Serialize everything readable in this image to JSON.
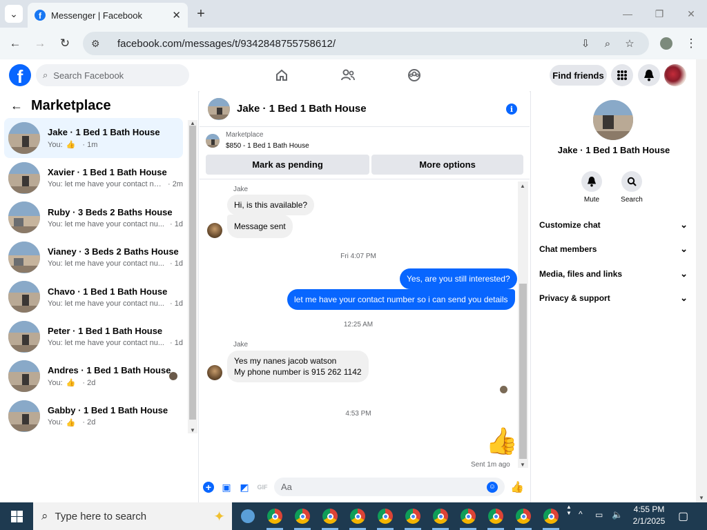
{
  "browser": {
    "tab_title": "Messenger | Facebook",
    "tab_favicon": "facebook-icon",
    "url": "facebook.com/messages/t/9342848755758612/"
  },
  "fb": {
    "search_placeholder": "Search Facebook",
    "find_friends": "Find friends"
  },
  "left": {
    "title": "Marketplace",
    "conversations": [
      {
        "name": "Jake · 1 Bed 1 Bath House",
        "prefix": "You:",
        "preview": "",
        "like": true,
        "time": "· 1m",
        "active": true
      },
      {
        "name": "Xavier · 1 Bed 1 Bath House",
        "prefix": "You:",
        "preview": "let me have your contact nu...",
        "like": false,
        "time": "· 2m",
        "active": false
      },
      {
        "name": "Ruby · 3 Beds 2 Baths House",
        "prefix": "You:",
        "preview": "let me have your contact nu...",
        "like": false,
        "time": "· 1d",
        "active": false
      },
      {
        "name": "Vianey · 3 Beds 2 Baths House",
        "prefix": "You:",
        "preview": "let me have your contact nu...",
        "like": false,
        "time": "· 1d",
        "active": false
      },
      {
        "name": "Chavo · 1 Bed 1 Bath House",
        "prefix": "You:",
        "preview": "let me have your contact nu...",
        "like": false,
        "time": "· 1d",
        "active": false
      },
      {
        "name": "Peter · 1 Bed 1 Bath House",
        "prefix": "You:",
        "preview": "let me have your contact nu...",
        "like": false,
        "time": "· 1d",
        "active": false
      },
      {
        "name": "Andres · 1 Bed 1 Bath House",
        "prefix": "You:",
        "preview": "",
        "like": true,
        "time": "· 2d",
        "active": false
      },
      {
        "name": "Gabby · 1 Bed 1 Bath House",
        "prefix": "You:",
        "preview": "",
        "like": true,
        "time": "· 2d",
        "active": false
      }
    ]
  },
  "chat": {
    "title": "Jake · 1 Bed 1 Bath House",
    "card_source": "Marketplace",
    "card_listing": "$850 - 1 Bed 1 Bath House",
    "btn_pending": "Mark as pending",
    "btn_more": "More options",
    "sender1": "Jake",
    "msg_available": "Hi, is this available?",
    "msg_sent_notice": "Message sent",
    "ts1": "Fri 4:07 PM",
    "out1": "Yes, are you still interested?",
    "out2": "let me have your contact number so i can send you details",
    "ts2": "12:25 AM",
    "sender2": "Jake",
    "in_reply_line1": "Yes my nanes jacob watson",
    "in_reply_line2": "My phone number is 915 262 1142",
    "ts3": "4:53 PM",
    "sent_status": "Sent 1m ago",
    "composer_placeholder": "Aa"
  },
  "right": {
    "name": "Jake · 1 Bed 1 Bath House",
    "mute": "Mute",
    "search": "Search",
    "sections": [
      "Customize chat",
      "Chat members",
      "Media, files and links",
      "Privacy & support"
    ]
  },
  "taskbar": {
    "search_placeholder": "Type here to search",
    "time": "4:55 PM",
    "date": "2/1/2025"
  },
  "colors": {
    "accent": "#0866ff",
    "bubble_in": "#f0f0f0",
    "active_row": "#ebf5ff"
  }
}
